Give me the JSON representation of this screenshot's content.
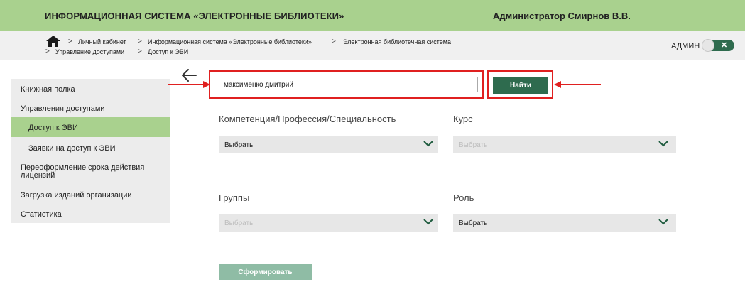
{
  "header": {
    "title": "ИНФОРМАЦИОННАЯ СИСТЕМА «ЭЛЕКТРОННЫЕ БИБЛИОТЕКИ»",
    "user": "Администратор Смирнов В.В."
  },
  "breadcrumb": {
    "items": [
      "Личный кабинет",
      "Информационная система «Электронные библиотеки»",
      "Электронная библиотечная система",
      "Управление доступами",
      "Доступ к ЭВИ"
    ],
    "separator": ">"
  },
  "role_toggle": {
    "label": "АДМИН",
    "close_glyph": "✕"
  },
  "sidebar": {
    "items": [
      {
        "label": "Книжная полка"
      },
      {
        "label": "Управления доступами"
      },
      {
        "label": "Доступ к ЭВИ"
      },
      {
        "label": "Заявки на доступ к ЭВИ"
      },
      {
        "label": "Переоформление срока действия лицензий"
      },
      {
        "label": "Загрузка изданий организации"
      },
      {
        "label": "Статистика"
      }
    ],
    "active_index": 2
  },
  "search": {
    "value": "максименко дмитрий",
    "button_label": "Найти"
  },
  "filters": {
    "competence": {
      "label": "Компетенция/Профессия/Специальность",
      "value": "Выбрать"
    },
    "course": {
      "label": "Курс",
      "value": "Выбрать"
    },
    "groups": {
      "label": "Группы",
      "value": "Выбрать"
    },
    "role": {
      "label": "Роль",
      "value": "Выбрать"
    }
  },
  "form_button_label": "Сформировать",
  "colors": {
    "header_green": "#a9d18e",
    "button_green": "#2e6b4e",
    "highlight_red": "#e02020",
    "disabled_button": "#8fbca5"
  },
  "icons": [
    "home-icon",
    "back-arrow-icon",
    "chevron-down-icon",
    "close-icon"
  ]
}
